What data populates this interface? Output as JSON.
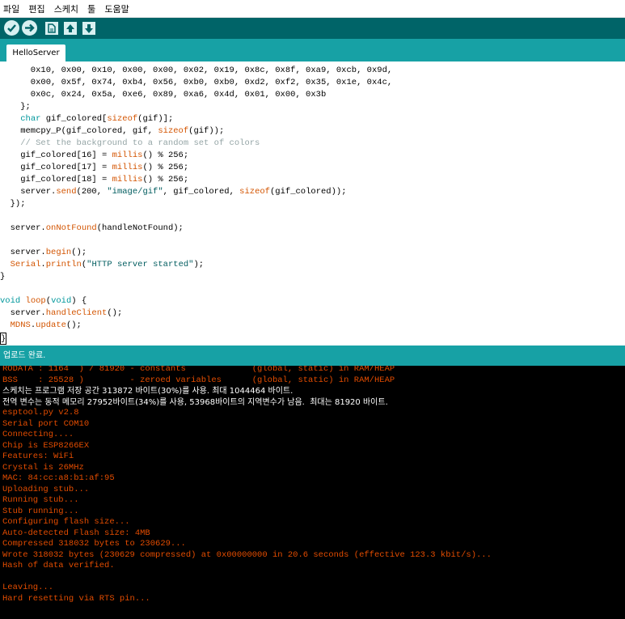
{
  "menu": [
    "파일",
    "편집",
    "스케치",
    "툴",
    "도움말"
  ],
  "toolbar": {
    "colors": {
      "bar": "#006468",
      "button": "#d8f0f1"
    },
    "buttons": [
      "verify-icon",
      "upload-icon",
      "new-icon",
      "open-icon",
      "save-icon"
    ]
  },
  "tab": {
    "label": "HelloServer"
  },
  "code": [
    [
      {
        "t": "      0x10, 0x00, 0x10, 0x00, 0x00, 0x02, 0x19, 0x8c, 0x8f, 0xa9, 0xcb, 0x9d,",
        "c": ""
      }
    ],
    [
      {
        "t": "      0x00, 0x5f, 0x74, 0xb4, 0x56, 0xb0, 0xb0, 0xd2, 0xf2, 0x35, 0x1e, 0x4c,",
        "c": ""
      }
    ],
    [
      {
        "t": "      0x0c, 0x24, 0x5a, 0xe6, 0x89, 0xa6, 0x4d, 0x01, 0x00, 0x3b",
        "c": ""
      }
    ],
    [
      {
        "t": "    };",
        "c": ""
      }
    ],
    [
      {
        "t": "    ",
        "c": ""
      },
      {
        "t": "char",
        "c": "ty"
      },
      {
        "t": " gif_colored[",
        "c": ""
      },
      {
        "t": "sizeof",
        "c": "kw"
      },
      {
        "t": "(gif)];",
        "c": ""
      }
    ],
    [
      {
        "t": "    memcpy_P(gif_colored, gif, ",
        "c": ""
      },
      {
        "t": "sizeof",
        "c": "kw"
      },
      {
        "t": "(gif));",
        "c": ""
      }
    ],
    [
      {
        "t": "    // Set the background to a random set of colors",
        "c": "cm"
      }
    ],
    [
      {
        "t": "    gif_colored[16] = ",
        "c": ""
      },
      {
        "t": "millis",
        "c": "kw"
      },
      {
        "t": "() % 256;",
        "c": ""
      }
    ],
    [
      {
        "t": "    gif_colored[17] = ",
        "c": ""
      },
      {
        "t": "millis",
        "c": "kw"
      },
      {
        "t": "() % 256;",
        "c": ""
      }
    ],
    [
      {
        "t": "    gif_colored[18] = ",
        "c": ""
      },
      {
        "t": "millis",
        "c": "kw"
      },
      {
        "t": "() % 256;",
        "c": ""
      }
    ],
    [
      {
        "t": "    server.",
        "c": ""
      },
      {
        "t": "send",
        "c": "kw"
      },
      {
        "t": "(200, ",
        "c": ""
      },
      {
        "t": "\"image/gif\"",
        "c": "str"
      },
      {
        "t": ", gif_colored, ",
        "c": ""
      },
      {
        "t": "sizeof",
        "c": "kw"
      },
      {
        "t": "(gif_colored));",
        "c": ""
      }
    ],
    [
      {
        "t": "  });",
        "c": ""
      }
    ],
    [
      {
        "t": "",
        "c": ""
      }
    ],
    [
      {
        "t": "  server.",
        "c": ""
      },
      {
        "t": "onNotFound",
        "c": "kw"
      },
      {
        "t": "(handleNotFound);",
        "c": ""
      }
    ],
    [
      {
        "t": "",
        "c": ""
      }
    ],
    [
      {
        "t": "  server.",
        "c": ""
      },
      {
        "t": "begin",
        "c": "kw"
      },
      {
        "t": "();",
        "c": ""
      }
    ],
    [
      {
        "t": "  ",
        "c": ""
      },
      {
        "t": "Serial",
        "c": "obj"
      },
      {
        "t": ".",
        "c": ""
      },
      {
        "t": "println",
        "c": "kw"
      },
      {
        "t": "(",
        "c": ""
      },
      {
        "t": "\"HTTP server started\"",
        "c": "str"
      },
      {
        "t": ");",
        "c": ""
      }
    ],
    [
      {
        "t": "}",
        "c": ""
      }
    ],
    [
      {
        "t": "",
        "c": ""
      }
    ],
    [
      {
        "t": "void",
        "c": "ty"
      },
      {
        "t": " ",
        "c": ""
      },
      {
        "t": "loop",
        "c": "kw"
      },
      {
        "t": "(",
        "c": ""
      },
      {
        "t": "void",
        "c": "ty"
      },
      {
        "t": ") {",
        "c": ""
      }
    ],
    [
      {
        "t": "  server.",
        "c": ""
      },
      {
        "t": "handleClient",
        "c": "kw"
      },
      {
        "t": "();",
        "c": ""
      }
    ],
    [
      {
        "t": "  ",
        "c": ""
      },
      {
        "t": "MDNS",
        "c": "obj"
      },
      {
        "t": ".",
        "c": ""
      },
      {
        "t": "update",
        "c": "kw"
      },
      {
        "t": "();",
        "c": ""
      }
    ],
    [
      {
        "t": "}",
        "c": "cursor"
      }
    ]
  ],
  "status": {
    "text": "업로드 완료."
  },
  "console": [
    {
      "t": "RODATA : 1164  ) / 81920 - constants             (global, static) in RAM/HEAP",
      "c": "o"
    },
    {
      "t": "BSS    : 25528 )         - zeroed variables      (global, static) in RAM/HEAP",
      "c": "o"
    },
    {
      "t": "스케치는 프로그램 저장 공간 313872 바이트(30%)를 사용. 최대 1044464 바이트.",
      "c": "w"
    },
    {
      "t": "전역 변수는 동적 메모리 27952바이트(34%)를 사용, 53968바이트의 지역변수가 남음.  최대는 81920 바이트.",
      "c": "w"
    },
    {
      "t": "esptool.py v2.8",
      "c": "o"
    },
    {
      "t": "Serial port COM10",
      "c": "o"
    },
    {
      "t": "Connecting....",
      "c": "o"
    },
    {
      "t": "Chip is ESP8266EX",
      "c": "o"
    },
    {
      "t": "Features: WiFi",
      "c": "o"
    },
    {
      "t": "Crystal is 26MHz",
      "c": "o"
    },
    {
      "t": "MAC: 84:cc:a8:b1:af:95",
      "c": "o"
    },
    {
      "t": "Uploading stub...",
      "c": "o"
    },
    {
      "t": "Running stub...",
      "c": "o"
    },
    {
      "t": "Stub running...",
      "c": "o"
    },
    {
      "t": "Configuring flash size...",
      "c": "o"
    },
    {
      "t": "Auto-detected Flash size: 4MB",
      "c": "o"
    },
    {
      "t": "Compressed 318032 bytes to 230629...",
      "c": "o"
    },
    {
      "t": "Wrote 318032 bytes (230629 compressed) at 0x00000000 in 20.6 seconds (effective 123.3 kbit/s)...",
      "c": "o"
    },
    {
      "t": "Hash of data verified.",
      "c": "o"
    },
    {
      "t": "",
      "c": "o"
    },
    {
      "t": "Leaving...",
      "c": "o"
    },
    {
      "t": "Hard resetting via RTS pin...",
      "c": "o"
    }
  ]
}
